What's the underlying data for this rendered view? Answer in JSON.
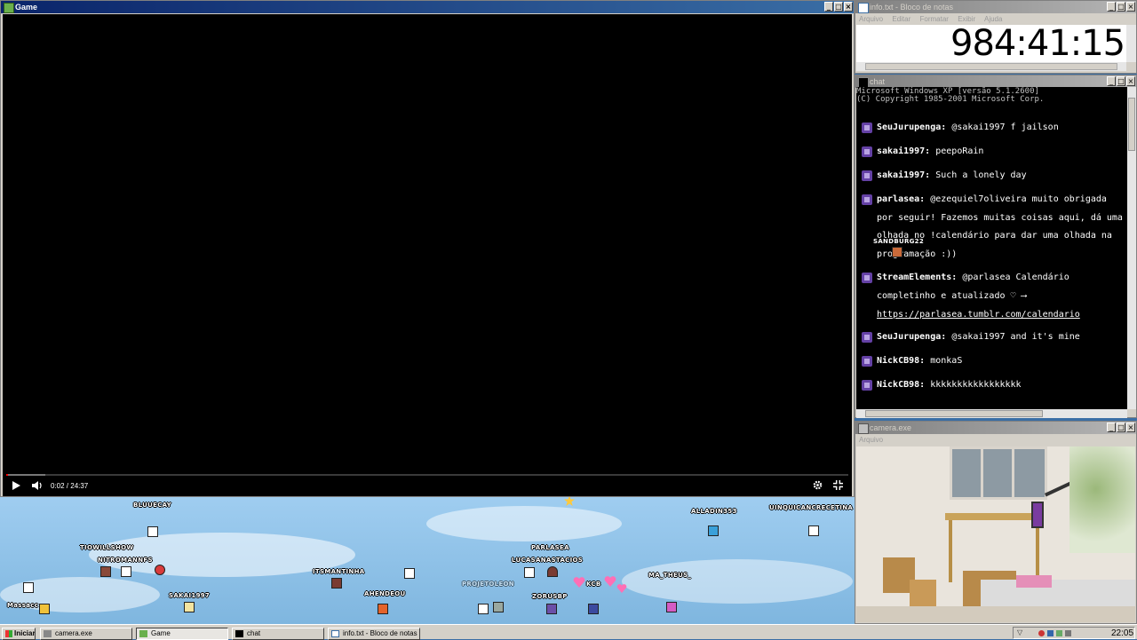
{
  "game_window": {
    "title": "Game",
    "player": {
      "time": "0:02 / 24:37",
      "progress": 0.0014
    }
  },
  "notepad_window": {
    "title": "info.txt - Bloco de notas",
    "menu": [
      "Arquivo",
      "Editar",
      "Formatar",
      "Exibir",
      "Ajuda"
    ],
    "timer": "984:41:15"
  },
  "chat_window": {
    "title": "chat",
    "console_header": [
      "Microsoft Windows XP [versão 5.1.2600]",
      "(C) Copyright 1985-2001 Microsoft Corp."
    ],
    "messages": [
      {
        "user": "SeuJurupenga:",
        "text": "@sakai1997 f jailson"
      },
      {
        "user": "sakai1997:",
        "text": "peepoRain"
      },
      {
        "user": "sakai1997:",
        "text": "Such a lonely day"
      },
      {
        "user": "parlasea:",
        "text": "@ezequiel7oliveira muito obrigada",
        "cont": [
          "por seguir! Fazemos muitas coisas aqui, dá uma",
          "olhada no !calendário para dar uma olhada na",
          "programação :))"
        ]
      },
      {
        "user": "StreamElements:",
        "text": "@parlasea Calendário",
        "cont": [
          "completinho e atualizado ♡ ⟶",
          "https://parlasea.tumblr.com/calendario"
        ]
      },
      {
        "user": "SeuJurupenga:",
        "text": "@sakai1997 and it's mine"
      },
      {
        "user": "NickCB98:",
        "text": "monkaS"
      },
      {
        "user": "NickCB98:",
        "text": "kkkkkkkkkkkkkkkkk"
      }
    ],
    "overlay_name": "SANDBURG22"
  },
  "camera_window": {
    "title": "camera.exe",
    "menu": [
      "Arquivo"
    ]
  },
  "stream_overlay": {
    "usernames": [
      "BLUUECAY",
      "TIOWILLSHOW",
      "NITROMANNFS",
      "SAKAI1997",
      "ITSMANTINHA",
      "AHENDEOU",
      "PROJETOLEON",
      "PARLASEA",
      "LUCASANASTACIOS",
      "ZORUSBP",
      "KCB",
      "MA_THEUS_",
      "ALLADIN353",
      "UINQUICANCRECETINA",
      "Massacc"
    ]
  },
  "taskbar": {
    "start_label": "Iniciar",
    "tasks": [
      "camera.exe",
      "Game",
      "chat",
      "info.txt - Bloco de notas"
    ],
    "clock": "22:05"
  },
  "colors": {
    "twitch_purple": "#6441a5",
    "title_active": "#0a246a",
    "sky": "#8cc4e8"
  }
}
